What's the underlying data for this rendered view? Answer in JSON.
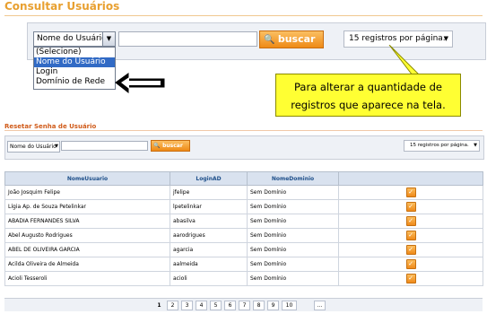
{
  "top": {
    "title": "Consultar Usuários",
    "search_select_value": "Nome do Usuário",
    "search_button": "buscar",
    "records_select_value": "15 registros por página.",
    "dropdown_options": [
      "(Selecione)",
      "Nome do Usuário",
      "Login",
      "Domínio de Rede"
    ],
    "callout_line1": "Para alterar a quantidade de",
    "callout_line2": "registros que aparece na tela."
  },
  "panel": {
    "title": "Resetar Senha de Usuário",
    "search_select_value": "Nome do Usuário",
    "search_button": "buscar",
    "records_select_value": "15 registros por página."
  },
  "table": {
    "headers": [
      "NomeUsuario",
      "LoginAD",
      "NomeDominio",
      ""
    ],
    "rows": [
      {
        "nome": "João Josquim Felipe",
        "login": "jfelipe",
        "dominio": "Sem Domínio"
      },
      {
        "nome": "Lígia Ap. de Souza Petelinkar",
        "login": "lpetelinkar",
        "dominio": "Sem Domínio"
      },
      {
        "nome": "ABADIA FERNANDES SILVA",
        "login": "abasilva",
        "dominio": "Sem Domínio"
      },
      {
        "nome": "Abel Augusto Rodrigues",
        "login": "aarodrigues",
        "dominio": "Sem Domínio"
      },
      {
        "nome": "ABEL DE OLIVEIRA GARCIA",
        "login": "agarcia",
        "dominio": "Sem Domínio"
      },
      {
        "nome": "Acilda Oliveira de Almeida",
        "login": "aalmeida",
        "dominio": "Sem Domínio"
      },
      {
        "nome": "Acioli Tesseroli",
        "login": "acioli",
        "dominio": "Sem Domínio"
      }
    ]
  },
  "pager": {
    "pages": [
      "1",
      "2",
      "3",
      "4",
      "5",
      "6",
      "7",
      "8",
      "9",
      "10",
      "..."
    ],
    "current": "1"
  },
  "colors": {
    "accent_orange": "#e8a030",
    "highlight_blue": "#316ac5",
    "callout_yellow": "#ffff33",
    "header_blue": "#1e4f8a"
  },
  "icons": {
    "search": "magnifier-icon",
    "edit": "edit-checkbox-icon",
    "arrow": "black-arrow-icon"
  }
}
